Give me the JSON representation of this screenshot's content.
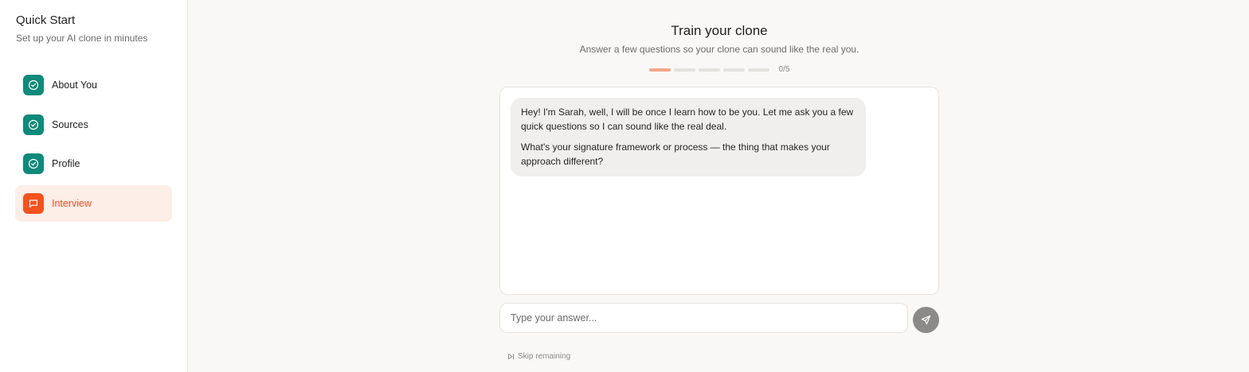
{
  "sidebar": {
    "title": "Quick Start",
    "subtitle": "Set up your AI clone in minutes",
    "steps": [
      {
        "label": "About You",
        "icon": "check-circle-icon",
        "status": "complete"
      },
      {
        "label": "Sources",
        "icon": "check-circle-icon",
        "status": "complete"
      },
      {
        "label": "Profile",
        "icon": "check-circle-icon",
        "status": "complete"
      },
      {
        "label": "Interview",
        "icon": "chat-bubble-icon",
        "status": "active"
      }
    ]
  },
  "main": {
    "title": "Train your clone",
    "subtitle": "Answer a few questions so your clone can sound like the real you.",
    "progress": {
      "current": 0,
      "total": 5,
      "label": "0/5"
    },
    "chat": {
      "messages": [
        {
          "role": "assistant",
          "paragraphs": [
            "Hey! I'm Sarah, well, I will be once I learn how to be you. Let me ask you a few quick questions so I can sound like the real deal.",
            "What's your signature framework or process — the thing that makes your approach different?"
          ]
        }
      ]
    },
    "input": {
      "placeholder": "Type your answer...",
      "value": ""
    },
    "send_button": {
      "icon": "send-icon"
    },
    "skip": {
      "label": "Skip remaining",
      "icon": "skip-forward-icon"
    }
  },
  "colors": {
    "complete": "#0f8a7a",
    "active": "#f4511e",
    "active_bg": "#fdeee8",
    "progress_filled": "#f4a58a",
    "progress_empty": "#e4e2de",
    "send_button": "#8c8a87"
  }
}
